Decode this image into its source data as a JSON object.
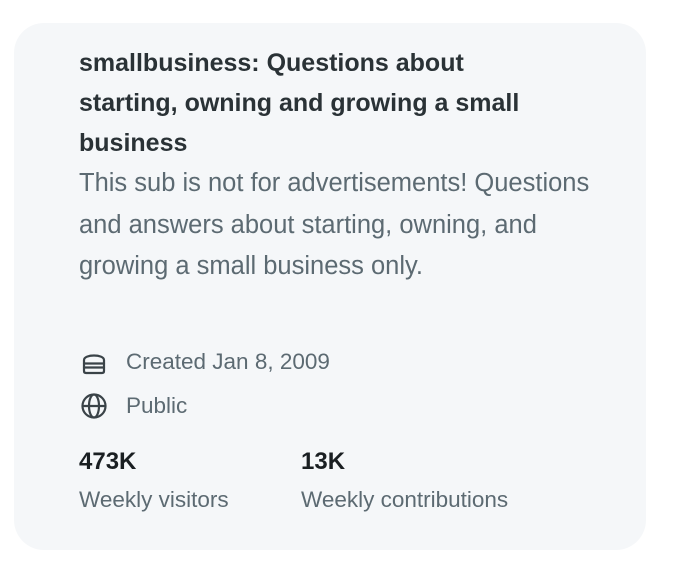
{
  "community": {
    "title": "smallbusiness: Questions about starting, owning and growing a small business",
    "description": "This sub is not for advertisements! Questions and answers about starting, owning, and growing a small business only."
  },
  "meta": {
    "created": {
      "icon": "cake-icon",
      "text": "Created Jan 8, 2009"
    },
    "visibility": {
      "icon": "globe-icon",
      "text": "Public"
    }
  },
  "stats": {
    "visitors": {
      "value": "473K",
      "label": "Weekly visitors"
    },
    "contributions": {
      "value": "13K",
      "label": "Weekly contributions"
    }
  },
  "colors": {
    "card_background": "#f5f7f9",
    "title_text": "#2a3236",
    "secondary_text": "#5c6a72",
    "stat_text": "#1a1f22"
  }
}
